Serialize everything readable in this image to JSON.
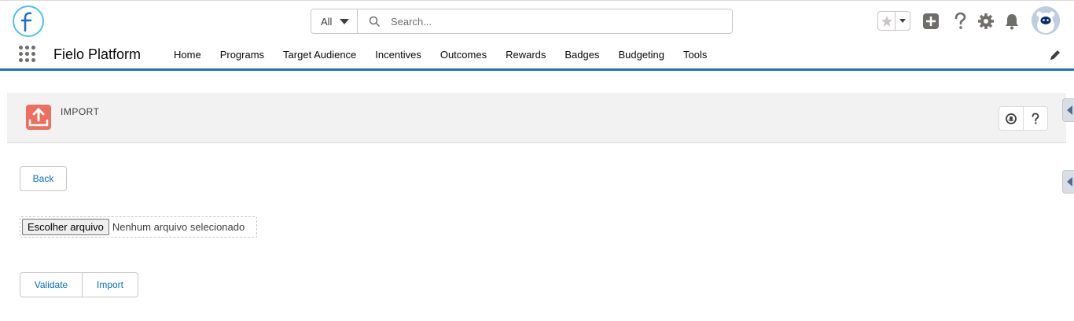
{
  "header": {
    "search": {
      "scope": "All",
      "placeholder": "Search..."
    },
    "icons": [
      "favorites-star-icon",
      "add-icon",
      "help-icon",
      "setup-gear-icon",
      "notifications-bell-icon",
      "user-avatar"
    ]
  },
  "nav": {
    "app_name": "Fielo Platform",
    "items": [
      {
        "label": "Home"
      },
      {
        "label": "Programs"
      },
      {
        "label": "Target Audience"
      },
      {
        "label": "Incentives"
      },
      {
        "label": "Outcomes"
      },
      {
        "label": "Rewards"
      },
      {
        "label": "Badges"
      },
      {
        "label": "Budgeting"
      },
      {
        "label": "Tools"
      }
    ]
  },
  "page": {
    "title": "IMPORT",
    "back_label": "Back",
    "file_button_label": "Escolher arquivo",
    "file_status": "Nenhum arquivo selecionado",
    "validate_label": "Validate",
    "import_label": "Import"
  },
  "colors": {
    "accent": "#1f6fc5",
    "link": "#0070d2",
    "import_icon": "#ee6e5f",
    "header_bg": "#f3f2f2"
  }
}
